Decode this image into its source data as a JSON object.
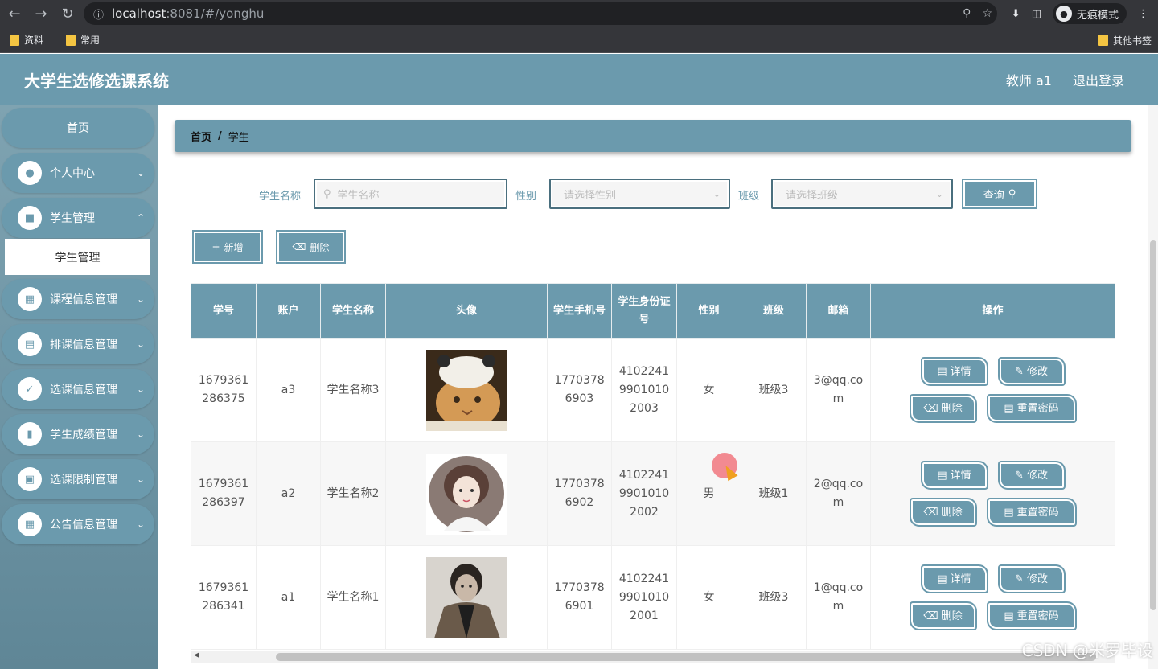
{
  "browser": {
    "url_host": "localhost",
    "url_path": ":8081/#/yonghu",
    "incognito_label": "无痕模式",
    "bookmarks": [
      "资料",
      "常用"
    ],
    "other_bookmarks": "其他书签"
  },
  "header": {
    "title": "大学生选修选课系统",
    "user": "教师 a1",
    "logout": "退出登录"
  },
  "sidebar": {
    "home": "首页",
    "items": [
      {
        "label": "个人中心",
        "icon": "user-icon"
      },
      {
        "label": "学生管理",
        "icon": "briefcase-icon"
      },
      {
        "label": "课程信息管理",
        "icon": "grid-icon"
      },
      {
        "label": "排课信息管理",
        "icon": "clipboard-icon"
      },
      {
        "label": "选课信息管理",
        "icon": "clipboard-check-icon"
      },
      {
        "label": "学生成绩管理",
        "icon": "bar-chart-icon"
      },
      {
        "label": "选课限制管理",
        "icon": "monitor-icon"
      },
      {
        "label": "公告信息管理",
        "icon": "grid-icon"
      }
    ],
    "sub_item": "学生管理"
  },
  "breadcrumb": {
    "home": "首页",
    "sep": "/",
    "current": "学生"
  },
  "search": {
    "name_label": "学生名称",
    "name_placeholder": "学生名称",
    "gender_label": "性别",
    "gender_placeholder": "请选择性别",
    "class_label": "班级",
    "class_placeholder": "请选择班级",
    "query_label": "查询"
  },
  "actions": {
    "add": "新增",
    "delete": "删除"
  },
  "table": {
    "headers": [
      "学号",
      "账户",
      "学生名称",
      "头像",
      "学生手机号",
      "学生身份证号",
      "性别",
      "班级",
      "邮箱",
      "操作"
    ],
    "rows": [
      {
        "id": "1679361286375",
        "account": "a3",
        "name": "学生名称3",
        "avatar": "cat-photo",
        "phone": "17703786903",
        "idcard": "410224199010102003",
        "gender": "女",
        "class": "班级3",
        "email": "3@qq.com"
      },
      {
        "id": "1679361286397",
        "account": "a2",
        "name": "学生名称2",
        "avatar": "illustrated-girl",
        "phone": "17703786902",
        "idcard": "410224199010102002",
        "gender": "男",
        "class": "班级1",
        "email": "2@qq.com"
      },
      {
        "id": "1679361286341",
        "account": "a1",
        "name": "学生名称1",
        "avatar": "man-photo",
        "phone": "17703786901",
        "idcard": "410224199010102001",
        "gender": "女",
        "class": "班级3",
        "email": "1@qq.com"
      }
    ],
    "row_actions": {
      "detail": "详情",
      "edit": "修改",
      "delete": "删除",
      "reset": "重置密码"
    }
  },
  "watermark": "CSDN @米罗毕设",
  "colors": {
    "primary": "#6b9aad",
    "dark_border": "#4a6f7e"
  }
}
